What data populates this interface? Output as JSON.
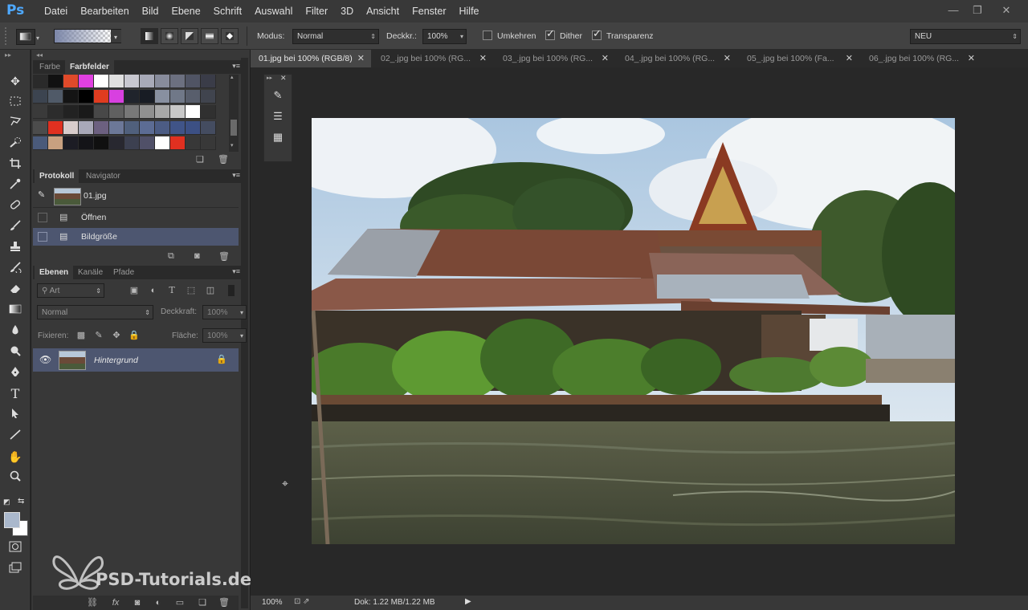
{
  "app": {
    "logo": "Ps"
  },
  "menu": [
    "Datei",
    "Bearbeiten",
    "Bild",
    "Ebene",
    "Schrift",
    "Auswahl",
    "Filter",
    "3D",
    "Ansicht",
    "Fenster",
    "Hilfe"
  ],
  "window_controls": [
    "—",
    "❐",
    "✕"
  ],
  "options": {
    "modus_label": "Modus:",
    "modus_value": "Normal",
    "deckkraft_label": "Deckkr.:",
    "deckkraft_value": "100%",
    "umkehren_label": "Umkehren",
    "dither_label": "Dither",
    "transparenz_label": "Transparenz",
    "umkehren_checked": false,
    "dither_checked": true,
    "transparenz_checked": true,
    "workspace_value": "NEU"
  },
  "swatches_panel": {
    "tabs": [
      "Farbe",
      "Farbfelder"
    ],
    "active_tab": "Farbfelder",
    "colors": [
      "#2a2a2a",
      "#111111",
      "#e04a2a",
      "#e040e0",
      "#ffffff",
      "#e0e0e0",
      "#c8c8d0",
      "#a8aab8",
      "#888c9c",
      "#6c7080",
      "#505464",
      "#3a3c48",
      "#3c4450",
      "#505a68",
      "#141414",
      "#000000",
      "#e03c20",
      "#d840e0",
      "#20242c",
      "#181c24",
      "#8890a0",
      "#707888",
      "#585e6c",
      "#40444e",
      "#3a3a3a",
      "#2c2c2c",
      "#222222",
      "#1a1a1a",
      "#484848",
      "#606060",
      "#787878",
      "#909090",
      "#a8a8a8",
      "#c8c8c8",
      "#ffffff",
      "#303030",
      "#4c4c4c",
      "#e03020",
      "#d8cccc",
      "#a8a8b8",
      "#6c6080",
      "#6c7898",
      "#50607c",
      "#5c6c94",
      "#4c5c84",
      "#405488",
      "#3c5084",
      "#444c60",
      "#4a5a7a",
      "#c8a080",
      "#1c1c24",
      "#141418",
      "#101010",
      "#282830",
      "#3c4050",
      "#505068",
      "#ffffff",
      "#e03020",
      "#383838",
      "#383838"
    ]
  },
  "history_panel": {
    "tabs": [
      "Protokoll",
      "Navigator"
    ],
    "active_tab": "Protokoll",
    "snapshot": "01.jpg",
    "items": [
      "Öffnen",
      "Bildgröße"
    ],
    "selected": "Bildgröße"
  },
  "layers_panel": {
    "tabs": [
      "Ebenen",
      "Kanäle",
      "Pfade"
    ],
    "active_tab": "Ebenen",
    "filter_label": "Art",
    "blend_mode": "Normal",
    "opacity_label": "Deckkraft:",
    "opacity_value": "100%",
    "lock_label": "Fixieren:",
    "fill_label": "Fläche:",
    "fill_value": "100%",
    "layers": [
      {
        "name": "Hintergrund",
        "locked": true,
        "visible": true
      }
    ]
  },
  "documents": [
    {
      "title": "01.jpg bei 100% (RGB/8)",
      "active": true
    },
    {
      "title": "02_.jpg bei 100% (RG...",
      "active": false
    },
    {
      "title": "03_.jpg bei 100% (RG...",
      "active": false
    },
    {
      "title": "04_.jpg bei 100% (RG...",
      "active": false
    },
    {
      "title": "05_.jpg bei 100% (Fa...",
      "active": false
    },
    {
      "title": "06_.jpg bei 100% (RG...",
      "active": false
    }
  ],
  "status": {
    "zoom": "100%",
    "doc_info": "Dok: 1.22 MB/1.22 MB"
  },
  "watermark": {
    "text": "PSD-Tutorials.de"
  }
}
